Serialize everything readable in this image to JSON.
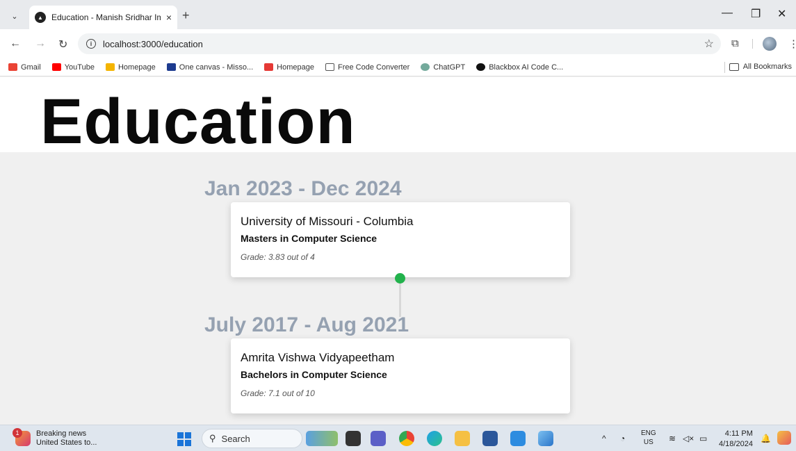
{
  "browser": {
    "tab_title": "Education - Manish Sridhar Im",
    "tab_close": "×",
    "new_tab": "+",
    "url": "localhost:3000/education",
    "bookmarks": [
      {
        "label": "Gmail",
        "color": "#ea4335"
      },
      {
        "label": "YouTube",
        "color": "#ff0000"
      },
      {
        "label": "Homepage",
        "color": "#f4b400"
      },
      {
        "label": "One canvas - Misso...",
        "color": "#1d3b8f"
      },
      {
        "label": "Homepage",
        "color": "#e53935"
      },
      {
        "label": "Free Code Converter",
        "color": "#555555"
      },
      {
        "label": "ChatGPT",
        "color": "#74aa9c"
      },
      {
        "label": "Blackbox AI Code C...",
        "color": "#111111"
      }
    ],
    "all_bookmarks": "All Bookmarks"
  },
  "page": {
    "heading": "Education",
    "entries": [
      {
        "date": "Jan 2023 - Dec 2024",
        "school": "University of Missouri - Columbia",
        "degree": "Masters in Computer Science",
        "grade": "Grade: 3.83 out of 4"
      },
      {
        "date": "July 2017 - Aug 2021",
        "school": "Amrita Vishwa Vidyapeetham",
        "degree": "Bachelors in Computer Science",
        "grade": "Grade: 7.1 out of 10"
      }
    ],
    "dot_color": "#22b24c"
  },
  "taskbar": {
    "news_title": "Breaking news",
    "news_sub": "United States to...",
    "news_badge": "1",
    "search_label": "Search",
    "lang_top": "ENG",
    "lang_bottom": "US",
    "time": "4:11 PM",
    "date": "4/18/2024"
  }
}
